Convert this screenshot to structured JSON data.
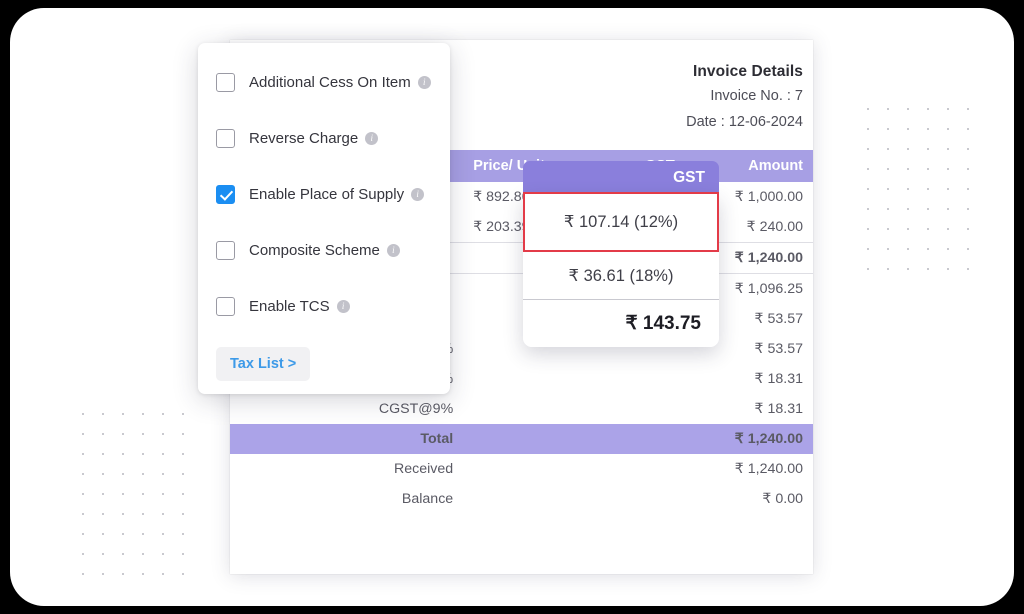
{
  "settings_panel": {
    "options": [
      {
        "label": "Additional Cess On Item",
        "checked": false,
        "info": "i"
      },
      {
        "label": "Reverse Charge",
        "checked": false,
        "info": "i"
      },
      {
        "label": "Enable Place of Supply",
        "checked": true,
        "info": "i"
      },
      {
        "label": "Composite Scheme",
        "checked": false,
        "info": "i"
      },
      {
        "label": "Enable TCS",
        "checked": false,
        "info": "i"
      }
    ],
    "tax_list_label": "Tax List >",
    "checked_color": "#1b8ef2",
    "link_color": "#3d9ae8"
  },
  "invoice": {
    "title": "Invoice Details",
    "invoice_no": "Invoice No. : 7",
    "date": "Date : 12-06-2024",
    "header_color": "#a79fe4",
    "total_row_color": "#aba3e8",
    "columns": {
      "price_per_unit": "Price/ Unit",
      "gst": "GST",
      "amount": "Amount"
    },
    "item_rows": [
      {
        "price": "₹ 892.86",
        "amount": "₹ 1,000.00"
      },
      {
        "price": "₹ 203.39",
        "amount": "₹ 240.00"
      }
    ],
    "subtotal_row": {
      "label": "",
      "amount": "₹ 1,240.00"
    },
    "tax_rows": [
      {
        "label": "",
        "amount": "₹ 1,096.25"
      },
      {
        "label": "",
        "amount": "₹ 53.57"
      },
      {
        "label": "CGST@6%",
        "amount": "₹ 53.57"
      },
      {
        "label": "SGST@9%",
        "amount": "₹ 18.31"
      },
      {
        "label": "CGST@9%",
        "amount": "₹ 18.31"
      }
    ],
    "total_row": {
      "label": "Total",
      "amount": "₹ 1,240.00"
    },
    "received_row": {
      "label": "Received",
      "amount": "₹ 1,240.00"
    },
    "balance_row": {
      "label": "Balance",
      "amount": "₹ 0.00"
    }
  },
  "gst_popup": {
    "header_label": "GST",
    "options": [
      {
        "text": "₹ 107.14 (12%)",
        "selected": true
      },
      {
        "text": "₹ 36.61 (18%)",
        "selected": false
      }
    ],
    "total": "₹ 143.75",
    "selection_border_color": "#e33b48",
    "header_highlight_color": "#8a7fdc"
  }
}
